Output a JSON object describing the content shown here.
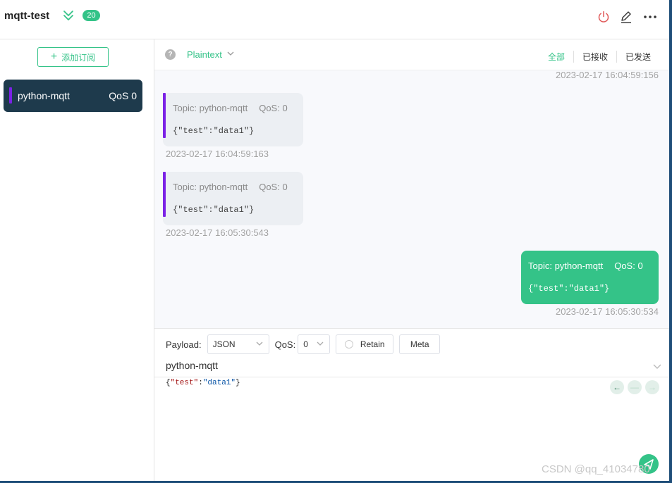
{
  "header": {
    "connection_name": "mqtt-test",
    "message_count": "20",
    "colors": {
      "accent": "#34c388",
      "power": "#e05a5a"
    },
    "icons": [
      "double-chevron-down-icon",
      "power-icon",
      "edit-icon",
      "more-icon"
    ]
  },
  "sidebar": {
    "add_subscription_label": "添加订阅",
    "subscriptions": [
      {
        "topic": "python-mqtt",
        "qos": "QoS 0",
        "color": "#7b22e6"
      }
    ]
  },
  "toolbar": {
    "format": "Plaintext",
    "filters": [
      "全部",
      "已接收",
      "已发送"
    ],
    "active_filter": "全部"
  },
  "messages": {
    "top_timestamp": "2023-02-17 16:04:59:156",
    "items": [
      {
        "direction": "received",
        "topic": "Topic: python-mqtt",
        "qos": "QoS: 0",
        "payload": "{\"test\":\"data1\"}",
        "time": "2023-02-17 16:04:59:163"
      },
      {
        "direction": "received",
        "topic": "Topic: python-mqtt",
        "qos": "QoS: 0",
        "payload": "{\"test\":\"data1\"}",
        "time": "2023-02-17 16:05:30:543"
      },
      {
        "direction": "sent",
        "topic": "Topic: python-mqtt",
        "qos": "QoS: 0",
        "payload": "{\"test\":\"data1\"}",
        "time": "2023-02-17 16:05:30:534"
      }
    ]
  },
  "publish": {
    "payload_label": "Payload:",
    "payload_format": "JSON",
    "qos_label": "QoS:",
    "qos_value": "0",
    "retain_label": "Retain",
    "meta_label": "Meta",
    "topic": "python-mqtt",
    "payload_parts": {
      "open": "{",
      "key": "\"test\"",
      "colon": ":",
      "value": "\"data1\"",
      "close": "}"
    }
  },
  "watermark": "CSDN @qq_41034780"
}
